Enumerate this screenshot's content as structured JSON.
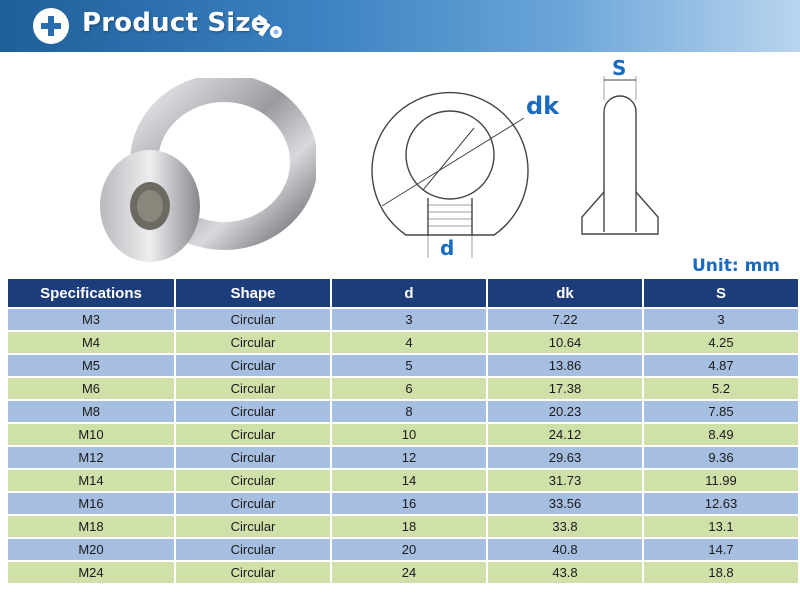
{
  "banner": {
    "title": "Product Size"
  },
  "diagram": {
    "dk_label": "dk",
    "d_label": "d",
    "s_label": "S"
  },
  "unit": "Unit: mm",
  "table": {
    "headers": [
      "Specifications",
      "Shape",
      "d",
      "dk",
      "S"
    ],
    "rows": [
      [
        "M3",
        "Circular",
        "3",
        "7.22",
        "3"
      ],
      [
        "M4",
        "Circular",
        "4",
        "10.64",
        "4.25"
      ],
      [
        "M5",
        "Circular",
        "5",
        "13.86",
        "4.87"
      ],
      [
        "M6",
        "Circular",
        "6",
        "17.38",
        "5.2"
      ],
      [
        "M8",
        "Circular",
        "8",
        "20.23",
        "7.85"
      ],
      [
        "M10",
        "Circular",
        "10",
        "24.12",
        "8.49"
      ],
      [
        "M12",
        "Circular",
        "12",
        "29.63",
        "9.36"
      ],
      [
        "M14",
        "Circular",
        "14",
        "31.73",
        "11.99"
      ],
      [
        "M16",
        "Circular",
        "16",
        "33.56",
        "12.63"
      ],
      [
        "M18",
        "Circular",
        "18",
        "33.8",
        "13.1"
      ],
      [
        "M20",
        "Circular",
        "20",
        "40.8",
        "14.7"
      ],
      [
        "M24",
        "Circular",
        "24",
        "43.8",
        "18.8"
      ]
    ]
  },
  "colors": {
    "header_bg": "#1c3d7a",
    "row_blue": "#a6bee0",
    "row_green": "#cfe0a9",
    "dimension_blue": "#1a6bbf"
  },
  "icons": [
    "plus-icon",
    "bolt-nut-icon"
  ]
}
